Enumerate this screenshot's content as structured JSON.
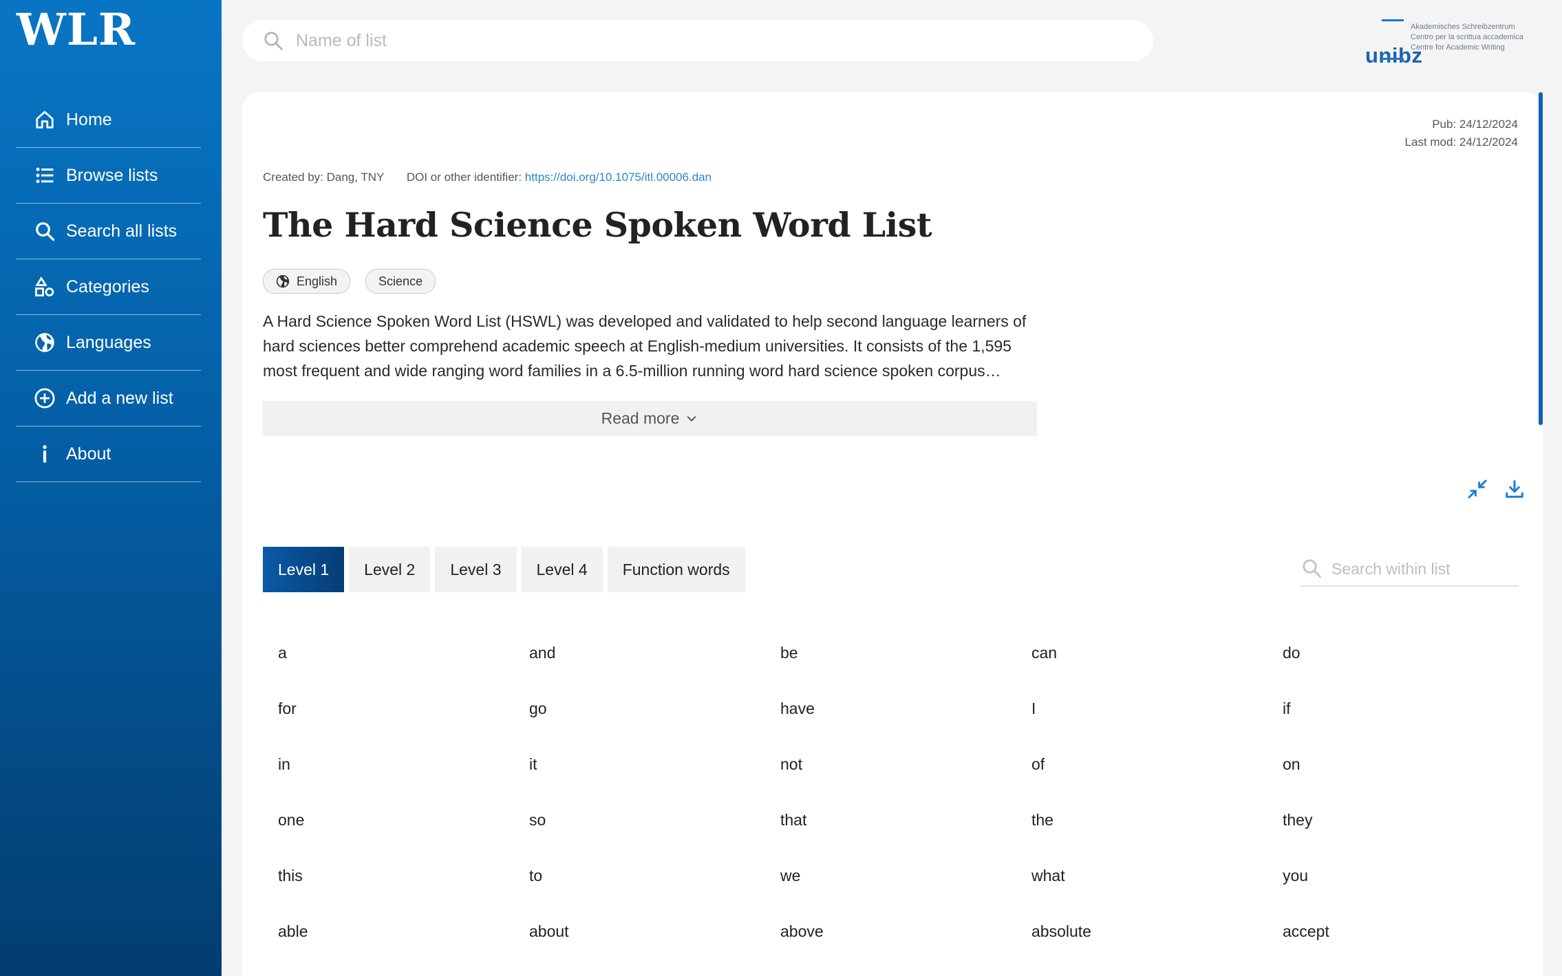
{
  "app": {
    "brand": "WLR"
  },
  "sidebar": {
    "items": [
      {
        "label": "Home",
        "icon": "home-icon"
      },
      {
        "label": "Browse lists",
        "icon": "list-icon"
      },
      {
        "label": "Search all lists",
        "icon": "search-icon"
      },
      {
        "label": "Categories",
        "icon": "shapes-icon"
      },
      {
        "label": "Languages",
        "icon": "globe-icon"
      },
      {
        "label": "Add a new list",
        "icon": "plus-circle-icon"
      },
      {
        "label": "About",
        "icon": "info-icon"
      }
    ]
  },
  "top_search": {
    "placeholder": "Name of list"
  },
  "logo": {
    "word": "unibz",
    "lines": [
      "Akademisches Schreibzentrum",
      "Centro per la scrittua accademica",
      "Centre for Academic Writing"
    ]
  },
  "list": {
    "pub": "Pub: 24/12/2024",
    "last_mod": "Last mod: 24/12/2024",
    "created_by": "Created by: Dang, TNY",
    "doi_label": "DOI or other identifier:",
    "doi_value": "https://doi.org/10.1075/itl.00006.dan",
    "title": "The Hard Science Spoken Word List",
    "tags": [
      "English",
      "Science"
    ],
    "description": "A Hard Science Spoken Word List (HSWL) was developed and validated to help second language learners of hard sciences better comprehend academic speech at English-medium universities. It consists of the 1,595 most frequent and wide ranging word families in a 6.5-million running word hard science spoken corpus…",
    "read_more": "Read more"
  },
  "tabs": [
    "Level 1",
    "Level 2",
    "Level 3",
    "Level 4",
    "Function words"
  ],
  "active_tab": "Level 1",
  "inner_search": {
    "placeholder": "Search within list"
  },
  "words": [
    "a",
    "and",
    "be",
    "can",
    "do",
    "for",
    "go",
    "have",
    "I",
    "if",
    "in",
    "it",
    "not",
    "of",
    "on",
    "one",
    "so",
    "that",
    "the",
    "they",
    "this",
    "to",
    "we",
    "what",
    "you",
    "able",
    "about",
    "above",
    "absolute",
    "accept"
  ],
  "colors": {
    "accent": "#0a63b3",
    "link": "#2a86c9",
    "sidebar_top": "#0875c4",
    "sidebar_bottom": "#033d70"
  }
}
